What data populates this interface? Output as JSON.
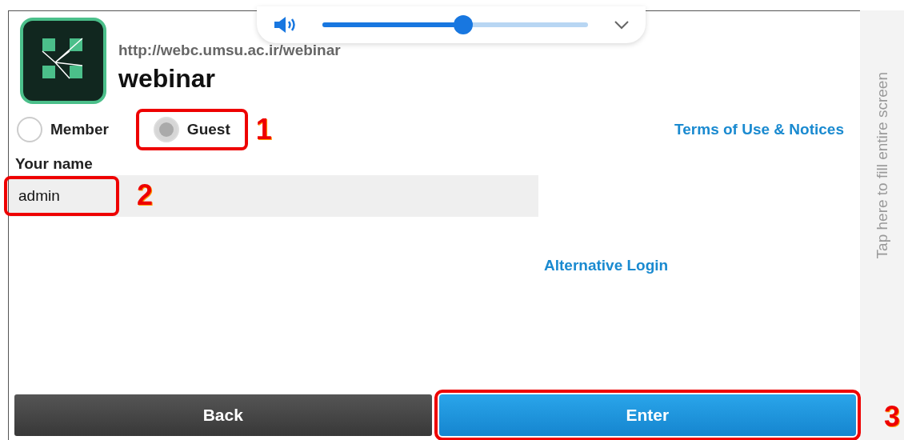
{
  "volume_popup": {
    "level": 0.53
  },
  "app": {
    "url": "http://webc.umsu.ac.ir/webinar",
    "title": "webinar"
  },
  "login_type": [
    {
      "label": "Member",
      "selected": false
    },
    {
      "label": "Guest",
      "selected": true,
      "annotation": "1"
    }
  ],
  "terms_link": "Terms of Use & Notices",
  "name_field": {
    "label": "Your name",
    "value": "admin",
    "annotation": "2"
  },
  "alternative_login": "Alternative Login",
  "buttons": [
    {
      "kind": "back",
      "label": "Back"
    },
    {
      "kind": "enter",
      "label": "Enter",
      "annotation": "3"
    }
  ],
  "side_hint": "Tap here to fill entire screen"
}
